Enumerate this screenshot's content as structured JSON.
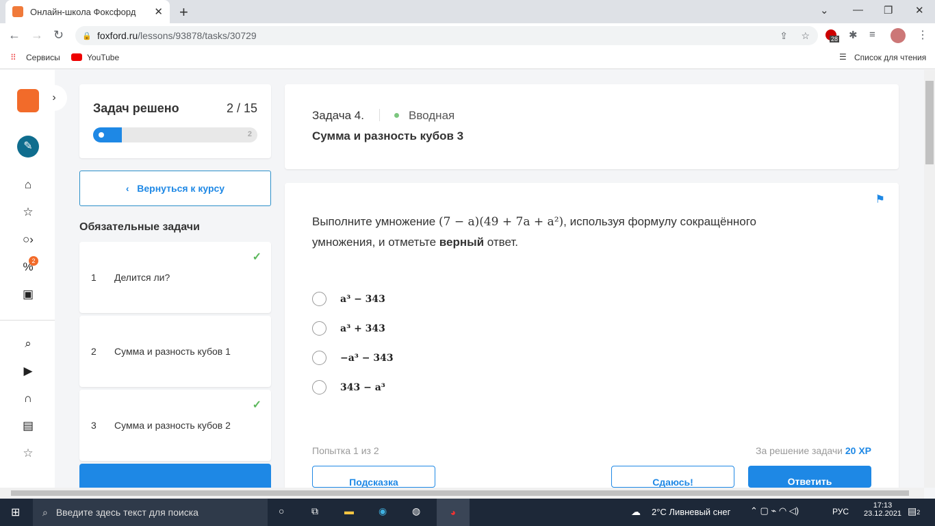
{
  "browser": {
    "tab_title": "Онлайн-школа Фоксфорд",
    "url_host": "foxford.ru",
    "url_path": "/lessons/93878/tasks/30729",
    "bookmarks": [
      "Сервисы",
      "YouTube"
    ],
    "reading_list": "Список для чтения",
    "extension_badge": "28"
  },
  "progress": {
    "title": "Задач решено",
    "count": "2 / 15",
    "solved": 2,
    "total": 15,
    "marker": "2"
  },
  "back_button": "Вернуться к курсу",
  "section_title": "Обязательные задачи",
  "tasks": [
    {
      "num": "1",
      "title": "Делится ли?",
      "done": true
    },
    {
      "num": "2",
      "title": "Сумма и разность кубов 1",
      "done": false
    },
    {
      "num": "3",
      "title": "Сумма и разность кубов 2",
      "done": true
    }
  ],
  "nav_badge": "2",
  "header": {
    "task_label": "Задача 4.",
    "level": "Вводная",
    "title": "Сумма и разность кубов 3",
    "level_color": "#7bc67e"
  },
  "question": {
    "prefix": "Выполните умножение ",
    "formula": "(7 − a)(49 + 7a + a²)",
    "mid": ", используя формулу сокращённого умножения, и отметьте ",
    "bold": "верный",
    "suffix": " ответ."
  },
  "options": [
    "a³ − 343",
    "a³ + 343",
    "−a³ − 343",
    "343 − a³"
  ],
  "attempt": "Попытка 1 из 2",
  "reward_label": "За решение задачи ",
  "reward_value": "20 XP",
  "buttons": {
    "hint": "Подсказка",
    "give_up": "Сдаюсь!",
    "answer": "Ответить"
  },
  "taskbar": {
    "search": "Введите здесь текст для поиска",
    "weather": "2°C  Ливневый снег",
    "lang": "РУС",
    "time": "17:13",
    "date": "23.12.2021",
    "notif": "2"
  },
  "colors": {
    "accent": "#1e88e5"
  }
}
